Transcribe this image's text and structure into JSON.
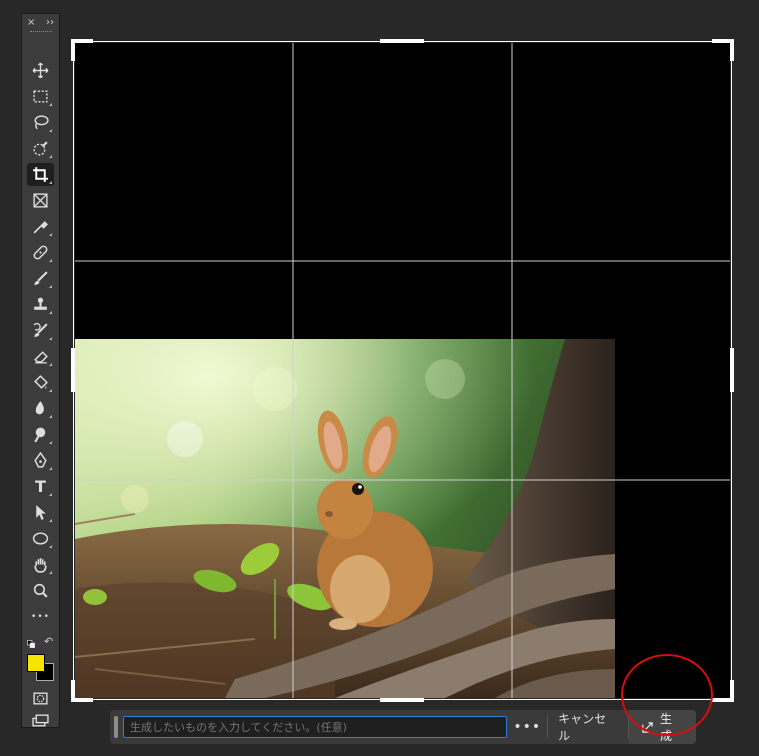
{
  "toolbar": {
    "close_glyph": "×",
    "collapse_glyph": "››",
    "tools": [
      {
        "name": "move-tool",
        "icon": "move-icon",
        "active": false
      },
      {
        "name": "marquee-tool",
        "icon": "marquee-icon",
        "active": false
      },
      {
        "name": "lasso-tool",
        "icon": "lasso-icon",
        "active": false
      },
      {
        "name": "quick-selection-tool",
        "icon": "quick-selection-icon",
        "active": false
      },
      {
        "name": "crop-tool",
        "icon": "crop-icon",
        "active": true
      },
      {
        "name": "frame-tool",
        "icon": "frame-icon",
        "active": false
      },
      {
        "name": "eyedropper-tool",
        "icon": "eyedropper-icon",
        "active": false
      },
      {
        "name": "healing-brush-tool",
        "icon": "bandage-icon",
        "active": false
      },
      {
        "name": "brush-tool",
        "icon": "brush-icon",
        "active": false
      },
      {
        "name": "clone-stamp-tool",
        "icon": "stamp-icon",
        "active": false
      },
      {
        "name": "history-brush-tool",
        "icon": "history-brush-icon",
        "active": false
      },
      {
        "name": "eraser-tool",
        "icon": "eraser-icon",
        "active": false
      },
      {
        "name": "paint-bucket-tool",
        "icon": "bucket-icon",
        "active": false
      },
      {
        "name": "blur-tool",
        "icon": "blur-icon",
        "active": false
      },
      {
        "name": "dodge-tool",
        "icon": "dodge-icon",
        "active": false
      },
      {
        "name": "pen-tool",
        "icon": "pen-icon",
        "active": false
      },
      {
        "name": "type-tool",
        "icon": "type-icon",
        "active": false
      },
      {
        "name": "path-selection-tool",
        "icon": "arrow-icon",
        "active": false
      },
      {
        "name": "ellipse-tool",
        "icon": "ellipse-icon",
        "active": false
      },
      {
        "name": "hand-tool",
        "icon": "hand-icon",
        "active": false
      },
      {
        "name": "zoom-tool",
        "icon": "zoom-icon",
        "active": false
      },
      {
        "name": "more-tools",
        "icon": "ellipsis-icon",
        "active": false
      }
    ],
    "type_letter": "T",
    "more_glyph": "•••",
    "swap_glyph": "↶",
    "foreground_color": "#f7e400",
    "background_color": "#000000"
  },
  "taskbar": {
    "prompt_placeholder": "生成したいものを入力してください。(任意)",
    "more_label": "•••",
    "cancel_label": "キャンセル",
    "generate_label": "生成"
  },
  "colors": {
    "annotation_circle": "#d40f0f",
    "prompt_focus": "#2f7ad8"
  }
}
